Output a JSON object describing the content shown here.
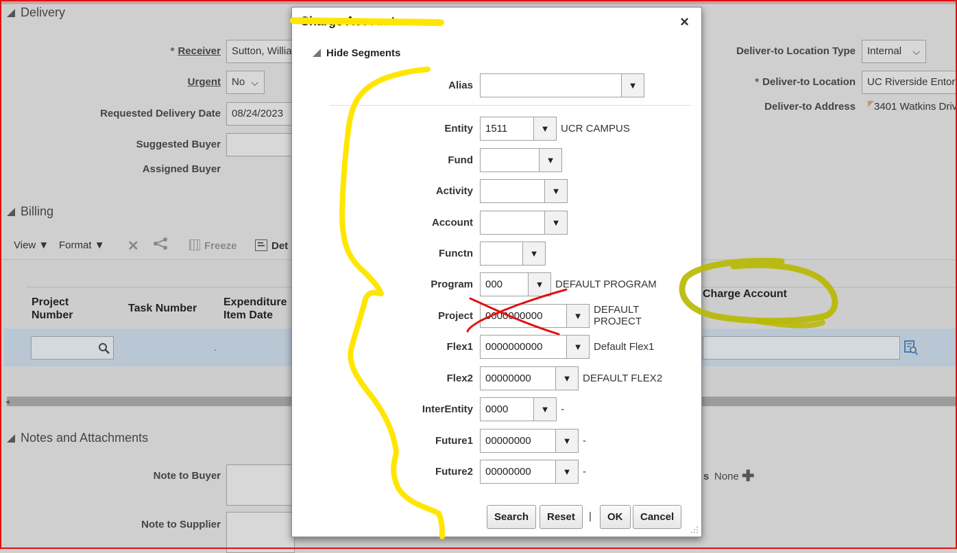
{
  "delivery": {
    "section_title": "Delivery",
    "receiver_label": "Receiver",
    "receiver_value": "Sutton, Willia",
    "urgent_label": "Urgent",
    "urgent_value": "No",
    "requested_date_label": "Requested Delivery Date",
    "requested_date_value": "08/24/2023",
    "suggested_buyer_label": "Suggested Buyer",
    "assigned_buyer_label": "Assigned Buyer",
    "loc_type_label": "Deliver-to Location Type",
    "loc_type_value": "Internal",
    "location_label": "Deliver-to Location",
    "location_value": "UC Riverside Entor",
    "address_label": "Deliver-to Address",
    "address_value": "3401 Watkins Driv"
  },
  "billing": {
    "section_title": "Billing",
    "view_label": "View",
    "format_label": "Format",
    "freeze_label": "Freeze",
    "detach_label": "Det",
    "columns": [
      "Project Number",
      "Task Number",
      "Expenditure Item Date",
      "Charge Account"
    ],
    "col_project_1": "Project",
    "col_project_2": "Number",
    "col_exp_1": "Expenditure",
    "col_exp_2": "Item Date",
    "row_dot": "."
  },
  "notes": {
    "section_title": "Notes and Attachments",
    "note_buyer_label": "Note to Buyer",
    "note_supplier_label": "Note to Supplier",
    "attachments_partial": "s",
    "attachments_value": "None"
  },
  "dialog": {
    "title": "Charge Account",
    "hide_segments": "Hide Segments",
    "alias_label": "Alias",
    "alias_value": "",
    "segments": [
      {
        "label": "Entity",
        "value": "1511",
        "desc": "UCR CAMPUS"
      },
      {
        "label": "Fund",
        "value": "",
        "desc": ""
      },
      {
        "label": "Activity",
        "value": "",
        "desc": ""
      },
      {
        "label": "Account",
        "value": "",
        "desc": ""
      },
      {
        "label": "Functn",
        "value": "",
        "desc": ""
      },
      {
        "label": "Program",
        "value": "000",
        "desc": "DEFAULT PROGRAM"
      },
      {
        "label": "Project",
        "value": "0000000000",
        "desc_1": "DEFAULT",
        "desc_2": "PROJECT"
      },
      {
        "label": "Flex1",
        "value": "0000000000",
        "desc": "Default Flex1"
      },
      {
        "label": "Flex2",
        "value": "00000000",
        "desc": "DEFAULT FLEX2"
      },
      {
        "label": "InterEntity",
        "value": "0000",
        "desc": "-"
      },
      {
        "label": "Future1",
        "value": "00000000",
        "desc": "-"
      },
      {
        "label": "Future2",
        "value": "00000000",
        "desc": "-"
      }
    ],
    "buttons": {
      "search": "Search",
      "reset": "Reset",
      "separator": "|",
      "ok": "OK",
      "cancel": "Cancel"
    }
  },
  "colors": {
    "highlight": "#ffe600",
    "annotation_red": "#e01010",
    "window_border": "#e01010"
  }
}
